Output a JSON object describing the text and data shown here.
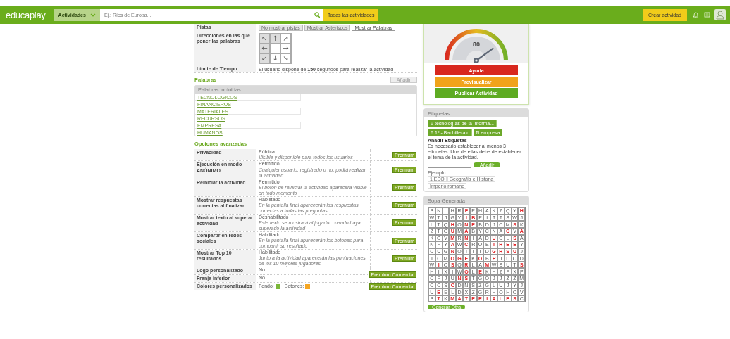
{
  "header": {
    "logo": "educaplay",
    "category": "Actividades",
    "search": {
      "placeholder": "Ej.: Ríos de Europa..."
    },
    "all_button": "Todas las actividades",
    "create_button": "Crear actividad"
  },
  "settings": {
    "hints": {
      "label": "Pistas",
      "options": [
        {
          "label": "No mostrar pistas",
          "selected": false
        },
        {
          "label": "Mostrar Asteriscos",
          "selected": false
        },
        {
          "label": "Mostrar Palabras",
          "selected": true
        }
      ]
    },
    "directions": {
      "label": "Direcciones en las que poner las palabras",
      "arrows": [
        {
          "symbol": "↖",
          "selected": false
        },
        {
          "symbol": "↑",
          "selected": false
        },
        {
          "symbol": "↗",
          "selected": true
        },
        {
          "symbol": "←",
          "selected": false
        },
        {
          "selected": true
        },
        {
          "symbol": "→",
          "selected": true
        },
        {
          "symbol": "↙",
          "selected": false
        },
        {
          "symbol": "↓",
          "selected": true
        },
        {
          "symbol": "↘",
          "selected": true
        }
      ]
    },
    "time_limit": {
      "label": "Límite de Tiempo",
      "text": "El usuario dispone de **150** segundos para realizar la actividad"
    }
  },
  "words": {
    "title": "Palabras",
    "add_button": {
      "label": "Añadir",
      "disabled": true
    },
    "list_title": "Palabras incluidas",
    "items": [
      "TECNOLOGICOS",
      "FINANCIEROS",
      "MATERIALES",
      "RECURSOS",
      "EMPRESA",
      "HUMANOS"
    ]
  },
  "advanced": {
    "title": "Opciones avanzadas",
    "rows": [
      {
        "kind": "option",
        "label": "Privacidad",
        "value": "Pública",
        "description": "Visible y disponible para todos los usuarios",
        "button": "Premium"
      },
      {
        "kind": "option",
        "label": "Ejecución en modo ANÓNIMO",
        "value": "Permitido",
        "description": "Cualquier usuario, registrado o no, podrá realizar la actividad",
        "button": "Premium"
      },
      {
        "kind": "option",
        "label": "Reiniciar la actividad",
        "value": "Permitido",
        "description": "El botón de reiniciar la actividad aparecerá visible en todo momento",
        "button": "Premium"
      },
      {
        "kind": "option",
        "label": "Mostrar respuestas correctas al finalizar",
        "value": "Habilitado",
        "description": "En la pantalla final aparecerán las respuestas correctas a todas las preguntas",
        "button": "Premium"
      },
      {
        "kind": "option",
        "label": "Mostrar texto al superar actividad",
        "value": "Deshabilitado",
        "description": "Este texto se mostrará al jugador cuando haya superado la actividad",
        "button": "Premium"
      },
      {
        "kind": "option",
        "label": "Compartir en redes sociales",
        "value": "Habilitado",
        "description": "En la pantalla final aparecerán los botones para compartir su resultado",
        "button": "Premium"
      },
      {
        "kind": "option",
        "label": "Mostrar Top 10 resultados",
        "value": "Habilitado",
        "description": "Junto a la actividad aparecerán las puntuaciones de los 10 mejores jugadores",
        "button": "Premium"
      },
      {
        "kind": "group",
        "rows": [
          {
            "label": "Logo personalizado",
            "value": "No"
          },
          {
            "label": "Franja inferior",
            "value": "No"
          }
        ],
        "button": "Premium Comercial"
      },
      {
        "kind": "colors",
        "label": "Colores personalizados",
        "swatches": [
          {
            "label": "Fondo:",
            "color": "#7cb83a"
          },
          {
            "label": "Botones:",
            "color": "#f5a623"
          }
        ],
        "button": "Premium Comercial"
      }
    ]
  },
  "score": {
    "value": "80",
    "buttons": [
      {
        "label": "Ayuda",
        "kind": "danger"
      },
      {
        "label": "Previsualizar",
        "kind": "warning"
      },
      {
        "label": "Publicar Actividad",
        "kind": "primary"
      }
    ]
  },
  "tags": {
    "title": "Etiquetas",
    "items": [
      "tecnologías de la informa...",
      "1º - Bachillerato",
      "empresa"
    ],
    "add_title": "Añadir Etiquetas",
    "help": "Es necesario establecer al menos 3 etiquetas. Una de ellas debe de establecer el tema de la actividad.",
    "add_button": "Añadir",
    "example_label": "Ejemplo:",
    "examples": [
      "1 ESO",
      "Geografía e Historia",
      "Imperio romano"
    ]
  },
  "soup": {
    "title": "Sopa Generada",
    "rows": [
      [
        {
          "letter": "B",
          "found": false
        },
        {
          "letter": "N",
          "found": false
        },
        {
          "letter": "L",
          "found": false
        },
        {
          "letter": "H",
          "found": false
        },
        {
          "letter": "R",
          "found": false
        },
        {
          "letter": "F",
          "found": true
        },
        {
          "letter": "P",
          "found": false
        },
        {
          "letter": "H",
          "found": false
        },
        {
          "letter": "A",
          "found": false
        },
        {
          "letter": "K",
          "found": false
        },
        {
          "letter": "Z",
          "found": false
        },
        {
          "letter": "Q",
          "found": false
        },
        {
          "letter": "Y",
          "found": false
        },
        {
          "letter": "H",
          "found": true
        }
      ],
      [
        {
          "letter": "W",
          "found": false
        },
        {
          "letter": "T",
          "found": false
        },
        {
          "letter": "J",
          "found": false
        },
        {
          "letter": "G",
          "found": false
        },
        {
          "letter": "Y",
          "found": false
        },
        {
          "letter": "I",
          "found": true
        },
        {
          "letter": "B",
          "found": true
        },
        {
          "letter": "P",
          "found": false
        },
        {
          "letter": "I",
          "found": false
        },
        {
          "letter": "T",
          "found": false
        },
        {
          "letter": "T",
          "found": false
        },
        {
          "letter": "S",
          "found": false
        },
        {
          "letter": "W",
          "found": false
        },
        {
          "letter": "J",
          "found": false
        }
      ],
      [
        {
          "letter": "L",
          "found": false
        },
        {
          "letter": "T",
          "found": false
        },
        {
          "letter": "Q",
          "found": false
        },
        {
          "letter": "H",
          "found": true
        },
        {
          "letter": "O",
          "found": false
        },
        {
          "letter": "N",
          "found": true
        },
        {
          "letter": "E",
          "found": true
        },
        {
          "letter": "B",
          "found": false
        },
        {
          "letter": "D",
          "found": false
        },
        {
          "letter": "J",
          "found": false
        },
        {
          "letter": "C",
          "found": false
        },
        {
          "letter": "M",
          "found": false
        },
        {
          "letter": "S",
          "found": true
        },
        {
          "letter": "K",
          "found": false
        }
      ],
      [
        {
          "letter": "Z",
          "found": false
        },
        {
          "letter": "T",
          "found": false
        },
        {
          "letter": "G",
          "found": false
        },
        {
          "letter": "U",
          "found": true
        },
        {
          "letter": "M",
          "found": false
        },
        {
          "letter": "A",
          "found": true
        },
        {
          "letter": "B",
          "found": false
        },
        {
          "letter": "Y",
          "found": false
        },
        {
          "letter": "C",
          "found": false
        },
        {
          "letter": "N",
          "found": false
        },
        {
          "letter": "A",
          "found": false
        },
        {
          "letter": "O",
          "found": true
        },
        {
          "letter": "V",
          "found": false
        },
        {
          "letter": "A",
          "found": true
        }
      ],
      [
        {
          "letter": "K",
          "found": false
        },
        {
          "letter": "G",
          "found": false
        },
        {
          "letter": "V",
          "found": false
        },
        {
          "letter": "M",
          "found": true
        },
        {
          "letter": "R",
          "found": false
        },
        {
          "letter": "N",
          "found": true
        },
        {
          "letter": "I",
          "found": false
        },
        {
          "letter": "A",
          "found": false
        },
        {
          "letter": "D",
          "found": false
        },
        {
          "letter": "U",
          "found": true
        },
        {
          "letter": "C",
          "found": false
        },
        {
          "letter": "L",
          "found": false
        },
        {
          "letter": "S",
          "found": true
        },
        {
          "letter": "A",
          "found": false
        }
      ],
      [
        {
          "letter": "N",
          "found": false
        },
        {
          "letter": "F",
          "found": false
        },
        {
          "letter": "Y",
          "found": false
        },
        {
          "letter": "A",
          "found": true
        },
        {
          "letter": "W",
          "found": false
        },
        {
          "letter": "C",
          "found": true
        },
        {
          "letter": "R",
          "found": false
        },
        {
          "letter": "O",
          "found": false
        },
        {
          "letter": "E",
          "found": false
        },
        {
          "letter": "I",
          "found": true
        },
        {
          "letter": "R",
          "found": true
        },
        {
          "letter": "E",
          "found": true
        },
        {
          "letter": "E",
          "found": true
        },
        {
          "letter": "Y",
          "found": false
        }
      ],
      [
        {
          "letter": "C",
          "found": false
        },
        {
          "letter": "U",
          "found": false
        },
        {
          "letter": "G",
          "found": false
        },
        {
          "letter": "N",
          "found": true
        },
        {
          "letter": "O",
          "found": false
        },
        {
          "letter": "I",
          "found": false
        },
        {
          "letter": "I",
          "found": false
        },
        {
          "letter": "T",
          "found": false
        },
        {
          "letter": "D",
          "found": false
        },
        {
          "letter": "G",
          "found": true
        },
        {
          "letter": "R",
          "found": true
        },
        {
          "letter": "S",
          "found": true
        },
        {
          "letter": "U",
          "found": true
        },
        {
          "letter": "J",
          "found": false
        }
      ],
      [
        {
          "letter": "I",
          "found": false
        },
        {
          "letter": "C",
          "found": false
        },
        {
          "letter": "M",
          "found": false
        },
        {
          "letter": "O",
          "found": true
        },
        {
          "letter": "G",
          "found": true
        },
        {
          "letter": "E",
          "found": true
        },
        {
          "letter": "K",
          "found": false
        },
        {
          "letter": "O",
          "found": true
        },
        {
          "letter": "B",
          "found": false
        },
        {
          "letter": "P",
          "found": true
        },
        {
          "letter": "J",
          "found": false
        },
        {
          "letter": "D",
          "found": false
        },
        {
          "letter": "O",
          "found": false
        },
        {
          "letter": "D",
          "found": false
        }
      ],
      [
        {
          "letter": "W",
          "found": false
        },
        {
          "letter": "I",
          "found": true
        },
        {
          "letter": "O",
          "found": false
        },
        {
          "letter": "S",
          "found": true
        },
        {
          "letter": "Q",
          "found": false
        },
        {
          "letter": "R",
          "found": true
        },
        {
          "letter": "L",
          "found": false
        },
        {
          "letter": "A",
          "found": false
        },
        {
          "letter": "M",
          "found": true
        },
        {
          "letter": "W",
          "found": false
        },
        {
          "letter": "S",
          "found": false
        },
        {
          "letter": "U",
          "found": false
        },
        {
          "letter": "T",
          "found": false
        },
        {
          "letter": "S",
          "found": true
        }
      ],
      [
        {
          "letter": "H",
          "found": false
        },
        {
          "letter": "I",
          "found": false
        },
        {
          "letter": "X",
          "found": false
        },
        {
          "letter": "I",
          "found": false
        },
        {
          "letter": "W",
          "found": false
        },
        {
          "letter": "O",
          "found": true
        },
        {
          "letter": "L",
          "found": false
        },
        {
          "letter": "E",
          "found": true
        },
        {
          "letter": "K",
          "found": false
        },
        {
          "letter": "H",
          "found": false
        },
        {
          "letter": "Z",
          "found": false
        },
        {
          "letter": "F",
          "found": false
        },
        {
          "letter": "X",
          "found": false
        },
        {
          "letter": "P",
          "found": false
        }
      ],
      [
        {
          "letter": "C",
          "found": false
        },
        {
          "letter": "F",
          "found": false
        },
        {
          "letter": "J",
          "found": false
        },
        {
          "letter": "U",
          "found": false
        },
        {
          "letter": "N",
          "found": true
        },
        {
          "letter": "S",
          "found": true
        },
        {
          "letter": "T",
          "found": false
        },
        {
          "letter": "G",
          "found": false
        },
        {
          "letter": "O",
          "found": false
        },
        {
          "letter": "J",
          "found": false
        },
        {
          "letter": "J",
          "found": false
        },
        {
          "letter": "Z",
          "found": false
        },
        {
          "letter": "Z",
          "found": false
        },
        {
          "letter": "M",
          "found": false
        }
      ],
      [
        {
          "letter": "C",
          "found": false
        },
        {
          "letter": "C",
          "found": false
        },
        {
          "letter": "S",
          "found": false
        },
        {
          "letter": "C",
          "found": true
        },
        {
          "letter": "D",
          "found": false
        },
        {
          "letter": "N",
          "found": false
        },
        {
          "letter": "S",
          "found": false
        },
        {
          "letter": "Z",
          "found": false
        },
        {
          "letter": "G",
          "found": false
        },
        {
          "letter": "L",
          "found": false
        },
        {
          "letter": "U",
          "found": false
        },
        {
          "letter": "J",
          "found": false
        },
        {
          "letter": "Y",
          "found": false
        },
        {
          "letter": "J",
          "found": false
        }
      ],
      [
        {
          "letter": "U",
          "found": false
        },
        {
          "letter": "E",
          "found": true
        },
        {
          "letter": "E",
          "found": false
        },
        {
          "letter": "L",
          "found": false
        },
        {
          "letter": "D",
          "found": false
        },
        {
          "letter": "X",
          "found": false
        },
        {
          "letter": "Z",
          "found": false
        },
        {
          "letter": "G",
          "found": false
        },
        {
          "letter": "R",
          "found": false
        },
        {
          "letter": "H",
          "found": false
        },
        {
          "letter": "O",
          "found": false
        },
        {
          "letter": "H",
          "found": false
        },
        {
          "letter": "O",
          "found": false
        },
        {
          "letter": "V",
          "found": false
        }
      ],
      [
        {
          "letter": "B",
          "found": false
        },
        {
          "letter": "T",
          "found": true
        },
        {
          "letter": "K",
          "found": false
        },
        {
          "letter": "M",
          "found": true
        },
        {
          "letter": "A",
          "found": true
        },
        {
          "letter": "T",
          "found": true
        },
        {
          "letter": "E",
          "found": true
        },
        {
          "letter": "R",
          "found": true
        },
        {
          "letter": "I",
          "found": true
        },
        {
          "letter": "A",
          "found": true
        },
        {
          "letter": "L",
          "found": true
        },
        {
          "letter": "E",
          "found": true
        },
        {
          "letter": "S",
          "found": true
        },
        {
          "letter": "C",
          "found": false
        }
      ]
    ],
    "button": "Generar Otra"
  }
}
